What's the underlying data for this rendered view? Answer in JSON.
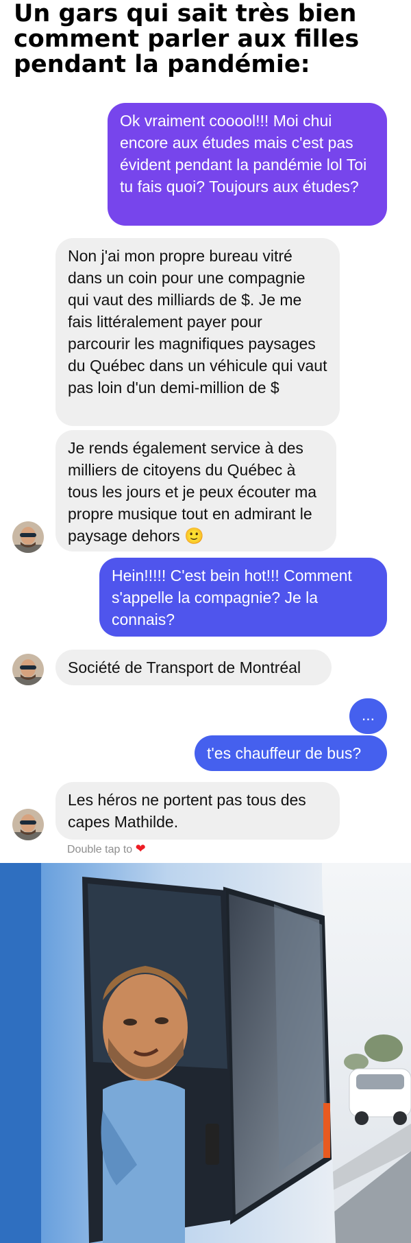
{
  "meme": {
    "title": "Un gars qui sait très bien comment parler aux filles pendant la pandémie:"
  },
  "conversation": {
    "messages": [
      {
        "sender": "me",
        "text": "Ok vraiment cooool!!! Moi chui encore aux études mais c'est pas évident pendant la pandémie lol Toi tu fais quoi? Toujours aux études?"
      },
      {
        "sender": "them",
        "text": "Non j'ai mon propre bureau vitré dans un coin pour une compagnie qui vaut des milliards de $. Je me fais littéralement payer pour parcourir les magnifiques paysages du Québec dans un véhicule qui vaut pas loin d'un demi-million de $"
      },
      {
        "sender": "them",
        "text": "Je rends également service à des milliers de citoyens du Québec à tous les jours et je peux écouter ma propre musique tout en admirant le paysage dehors 🙂"
      },
      {
        "sender": "me",
        "text": "Hein!!!!! C'est bein hot!!! Comment s'appelle la compagnie? Je la connais?"
      },
      {
        "sender": "them",
        "text": "Société de Transport de Montréal"
      },
      {
        "sender": "me",
        "text": "..."
      },
      {
        "sender": "me",
        "text": "t'es chauffeur de bus?"
      },
      {
        "sender": "them",
        "text": "Les héros ne portent pas tous des capes Mathilde."
      }
    ],
    "reaction_hint": "Double tap to",
    "reaction_icon": "heart-icon"
  },
  "colors": {
    "outgoing_top": "#7b45ec",
    "outgoing_bottom": "#4560ee",
    "incoming": "#efefef",
    "hint_text": "#8e8e8e"
  }
}
